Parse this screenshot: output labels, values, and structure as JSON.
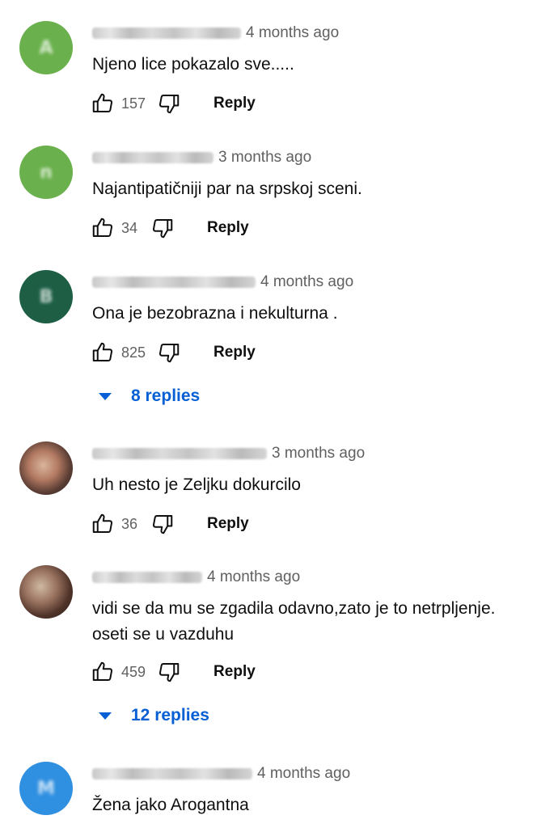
{
  "icons": {
    "like": "thumbs-up-icon",
    "dislike": "thumbs-down-icon",
    "expand": "caret-down-icon"
  },
  "colors": {
    "link": "#065fd4",
    "meta": "#606060",
    "text": "#0f0f0f"
  },
  "comments": [
    {
      "avatar_letter": "A",
      "avatar_color": "#6ab04c",
      "time": "4 months ago",
      "text": "Njeno lice pokazalo sve.....",
      "likes": "157",
      "reply_label": "Reply"
    },
    {
      "avatar_letter": "n",
      "avatar_color": "#6ab04c",
      "time": "3 months ago",
      "text": "Najantipatičniji par na srpskoj sceni.",
      "likes": "34",
      "reply_label": "Reply"
    },
    {
      "avatar_letter": "B",
      "avatar_color": "#1d5e45",
      "time": "4 months ago",
      "text": "Ona je bezobrazna i nekulturna .",
      "likes": "825",
      "reply_label": "Reply",
      "replies_label": "8 replies"
    },
    {
      "avatar_letter": "",
      "avatar_color": "#6b5046",
      "time": "3 months ago",
      "text": "Uh nesto je Zeljku dokurcilo",
      "likes": "36",
      "reply_label": "Reply"
    },
    {
      "avatar_letter": "",
      "avatar_color": "#7a5a48",
      "time": "4 months ago",
      "text_line1": "vidi se da mu se zgadila odavno,zato je to netrpljenje.",
      "text_line2": "oseti se u vazduhu",
      "likes": "459",
      "reply_label": "Reply",
      "replies_label": "12 replies"
    },
    {
      "avatar_letter": "M",
      "avatar_color": "#2f8fe0",
      "time": "4 months ago",
      "text": "Žena jako Arogantna"
    }
  ]
}
